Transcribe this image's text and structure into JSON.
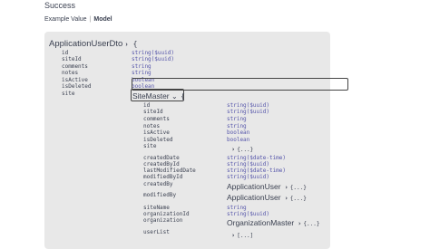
{
  "response": {
    "title": "Success"
  },
  "tabs": {
    "example_label": "Example Value",
    "separator": "|",
    "model_label": "Model"
  },
  "model": {
    "name": "ApplicationUserDto",
    "open_brace": "{",
    "properties": [
      {
        "name": "id",
        "type": "string($uuid)"
      },
      {
        "name": "siteId",
        "type": "string($uuid)"
      },
      {
        "name": "comments",
        "type": "string"
      },
      {
        "name": "notes",
        "type": "string"
      },
      {
        "name": "isActive",
        "type": "boolean"
      },
      {
        "name": "isDeleted",
        "type": "boolean"
      },
      {
        "name": "site",
        "type": ""
      }
    ]
  },
  "site_master": {
    "name": "SiteMaster",
    "chevron": "⌄",
    "open_brace": "{",
    "properties": [
      {
        "name": "id",
        "type": "string($uuid)"
      },
      {
        "name": "siteId",
        "type": "string($uuid)"
      },
      {
        "name": "comments",
        "type": "string"
      },
      {
        "name": "notes",
        "type": "string"
      },
      {
        "name": "isActive",
        "type": "boolean"
      },
      {
        "name": "isDeleted",
        "type": "boolean"
      },
      {
        "name": "site",
        "type": ""
      },
      {
        "name": "createdDate",
        "type": "string($date-time)"
      },
      {
        "name": "createdById",
        "type": "string($uuid)"
      },
      {
        "name": "lastModifiedDate",
        "type": "string($date-time)"
      },
      {
        "name": "modifiedById",
        "type": "string($uuid)"
      },
      {
        "name": "createdBy",
        "type": ""
      },
      {
        "name": "modifiedBy",
        "type": ""
      },
      {
        "name": "siteName",
        "type": "string"
      },
      {
        "name": "organizationId",
        "type": "string($uuid)"
      },
      {
        "name": "organization",
        "type": ""
      },
      {
        "name": "userList",
        "type": ""
      }
    ],
    "site_expander": "{...}",
    "created_by_ref": {
      "name": "ApplicationUser",
      "expander": "{...}"
    },
    "modified_by_ref": {
      "name": "ApplicationUser",
      "expander": "{...}"
    },
    "organization_ref": {
      "name": "OrganizationMaster",
      "expander": "{...}"
    },
    "user_list_expander": "[...]"
  },
  "colors": {
    "panel_bg": "#e8e8e8",
    "type_color": "#5555aa",
    "text": "#3b4151"
  }
}
